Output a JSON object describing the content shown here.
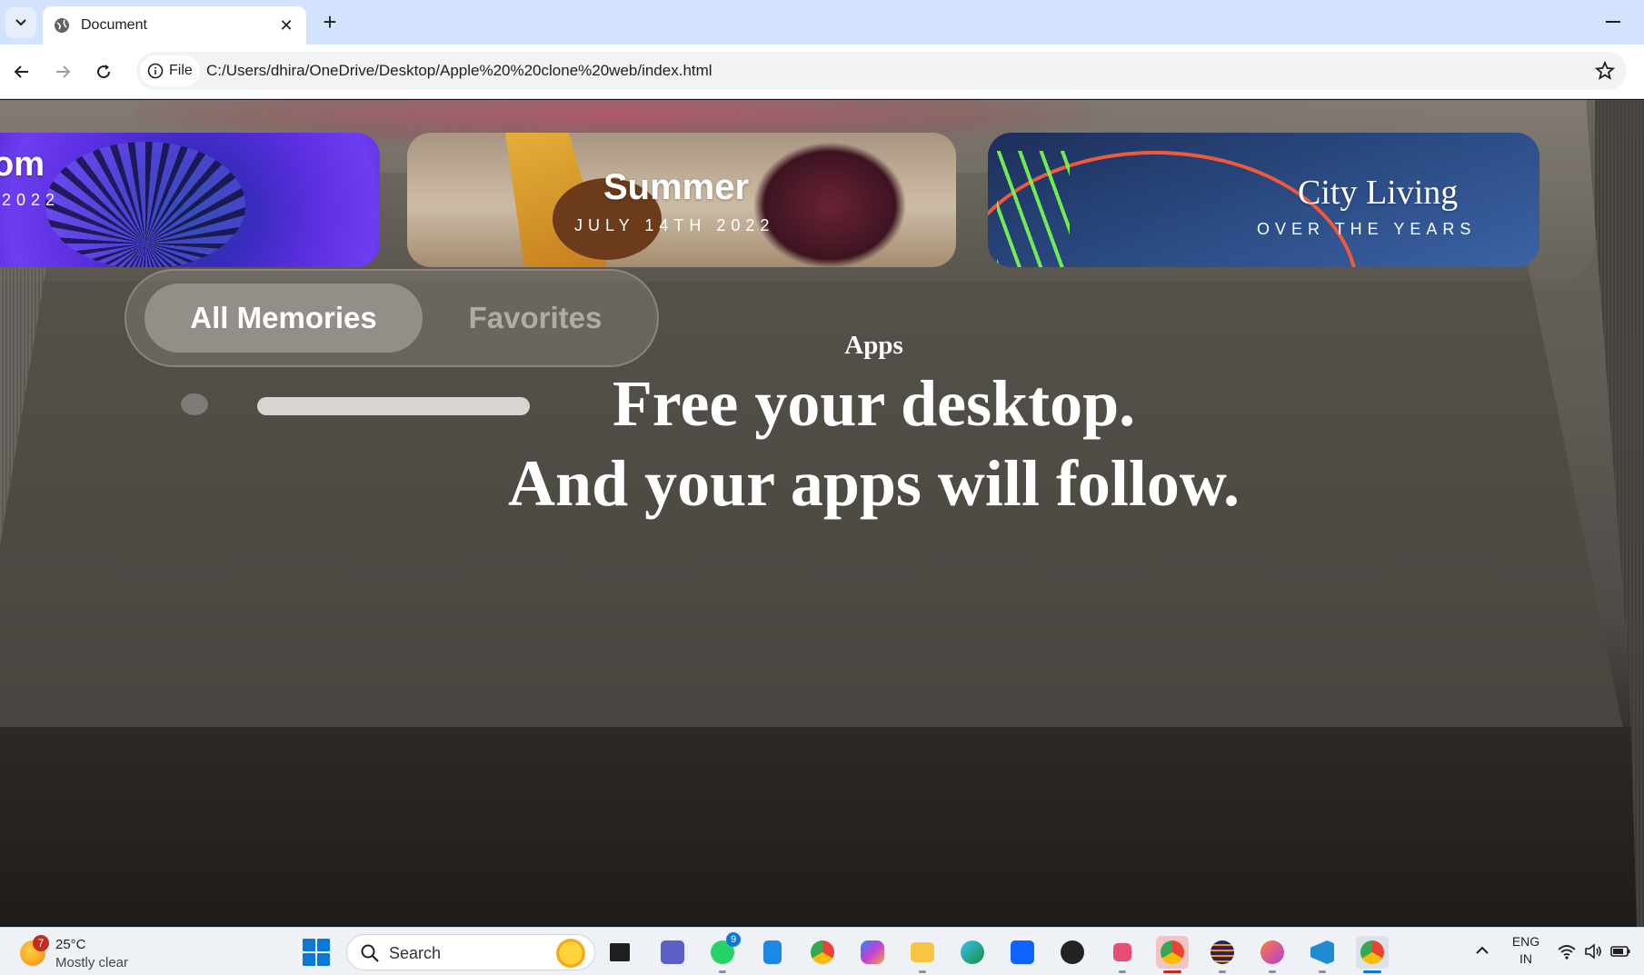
{
  "browser": {
    "tab_title": "Document",
    "tab_close": "✕",
    "new_tab": "+",
    "site_info_label": "File",
    "url": "C:/Users/dhira/OneDrive/Desktop/Apple%20%20clone%20web/index.html"
  },
  "page": {
    "cards": [
      {
        "title": "om",
        "subtitle": "2022"
      },
      {
        "title": "Summer",
        "subtitle": "JULY 14TH 2022"
      },
      {
        "title": "City Living",
        "subtitle": "OVER THE YEARS"
      }
    ],
    "segments": {
      "active": "All Memories",
      "other": "Favorites"
    },
    "section_label": "Apps",
    "headline_line1": "Free your desktop.",
    "headline_line2": "And your apps will follow."
  },
  "taskbar": {
    "weather_badge": "7",
    "temperature": "25°C",
    "condition": "Mostly clear",
    "search_label": "Search",
    "whatsapp_badge": "9",
    "lang_line1": "ENG",
    "lang_line2": "IN",
    "icons": [
      "start-icon",
      "task-view-icon",
      "teams-icon",
      "whatsapp-icon",
      "notepad-icon",
      "chrome-icon",
      "copilot-icon",
      "file-explorer-icon",
      "edge-icon",
      "sticky-app-icon",
      "media-app-icon",
      "snipping-tool-icon",
      "chrome-profile-icon",
      "eclipse-icon",
      "brave-icon",
      "vscode-icon",
      "chrome-active-icon"
    ]
  },
  "colors": {
    "tabstrip": "#d3e3fd",
    "accent": "#0a78d7",
    "headline": "#ffffff"
  }
}
